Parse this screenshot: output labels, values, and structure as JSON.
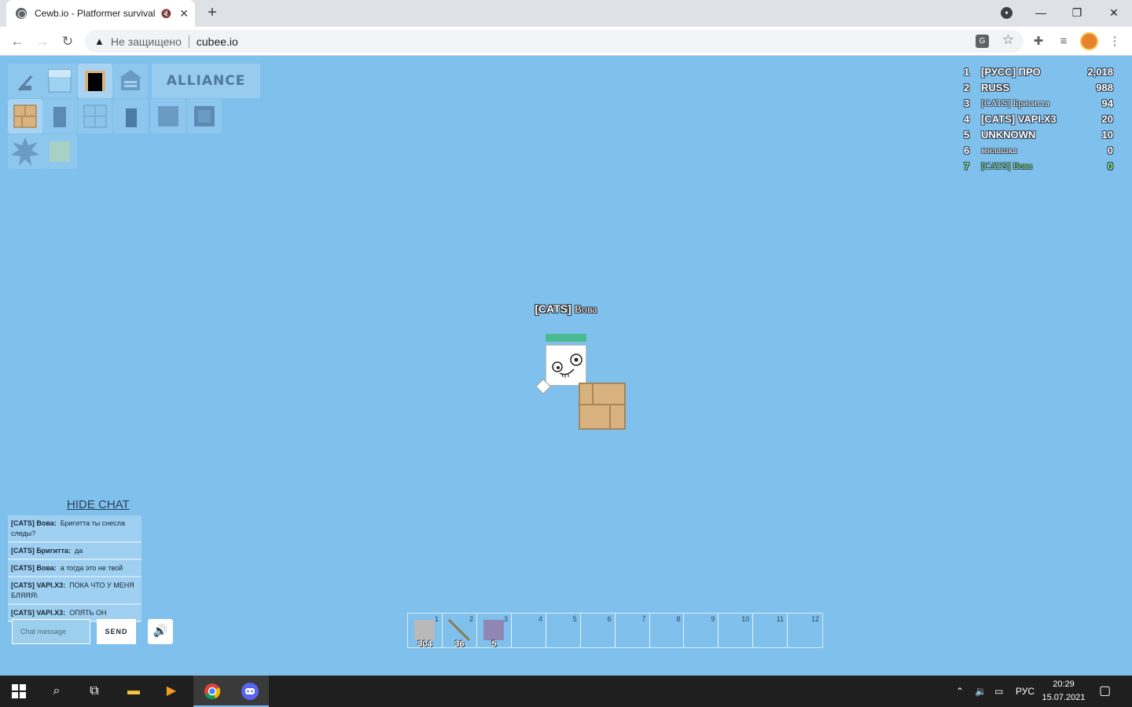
{
  "browser": {
    "tab_title": "Cewb.io - Platformer survival",
    "tab_mute_icon": "speaker-muted-icon",
    "new_tab_label": "+",
    "security_label": "Не защищено",
    "url": "cubee.io",
    "window_controls": {
      "minimize": "—",
      "restore": "❐",
      "close": "✕"
    }
  },
  "game": {
    "alliance_label": "ALLIANCE",
    "leaderboard": [
      {
        "rank": "1",
        "name": "[РУСС] ПРО",
        "score": "2,018"
      },
      {
        "rank": "2",
        "name": "RUSS",
        "score": "988"
      },
      {
        "rank": "3",
        "name": "[CATS] Бригитта",
        "score": "94"
      },
      {
        "rank": "4",
        "name": "[CATS] VAPI.X3",
        "score": "20"
      },
      {
        "rank": "5",
        "name": "UNKNOWN",
        "score": "10"
      },
      {
        "rank": "6",
        "name": "милашка",
        "score": "0"
      },
      {
        "rank": "7",
        "name": "[CATS] Вова",
        "score": "0"
      }
    ],
    "player": {
      "tag": "[CATS]",
      "name": "Вова",
      "health_fraction": 1.0
    }
  },
  "chat": {
    "hide_label": "HIDE CHAT",
    "messages": [
      {
        "author": "[CATS] Вова:",
        "text": "Бригитта ты снесла следы?"
      },
      {
        "author": "[CATS] Бригитта:",
        "text": "да"
      },
      {
        "author": "[CATS] Вова:",
        "text": "а тогда это не твой"
      },
      {
        "author": "[CATS] VAPI.X3:",
        "text": "ПОКА ЧТО У МЕНЯ БЛЯЯЯ\\"
      },
      {
        "author": "[CATS] VAPI.X3:",
        "text": "ОПЯТЬ ОН"
      }
    ],
    "input_placeholder": "Chat message",
    "send_label": "SEND"
  },
  "hotbar": [
    {
      "num": "1",
      "count": "304",
      "item": "stone-block"
    },
    {
      "num": "2",
      "count": "36",
      "item": "stick"
    },
    {
      "num": "3",
      "count": "5",
      "item": "purple-block"
    },
    {
      "num": "4",
      "count": ""
    },
    {
      "num": "5",
      "count": ""
    },
    {
      "num": "6",
      "count": ""
    },
    {
      "num": "7",
      "count": ""
    },
    {
      "num": "8",
      "count": ""
    },
    {
      "num": "9",
      "count": ""
    },
    {
      "num": "10",
      "count": ""
    },
    {
      "num": "11",
      "count": ""
    },
    {
      "num": "12",
      "count": ""
    }
  ],
  "taskbar": {
    "lang": "РУС",
    "time": "20:29",
    "date": "15.07.2021"
  },
  "colors": {
    "sky": "#7fc0ec",
    "health": "#4aba91",
    "my_rank": "#8cf08c"
  }
}
